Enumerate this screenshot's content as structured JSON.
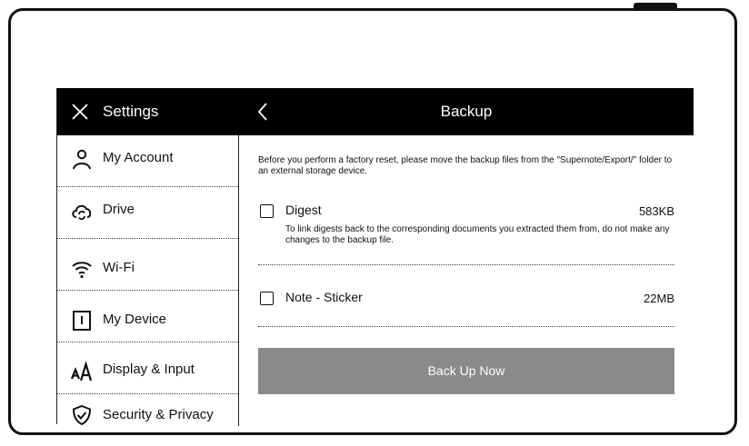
{
  "settings": {
    "title": "Settings",
    "close_icon": "close-icon"
  },
  "sidebar": {
    "items": [
      {
        "label": "My Account",
        "icon": "person-icon"
      },
      {
        "label": "Drive",
        "icon": "cloud-sync-icon"
      },
      {
        "label": "Wi-Fi",
        "icon": "wifi-icon"
      },
      {
        "label": "My Device",
        "icon": "tablet-icon"
      },
      {
        "label": "Display & Input",
        "icon": "font-size-icon"
      },
      {
        "label": "Security & Privacy",
        "icon": "shield-check-icon"
      }
    ]
  },
  "main": {
    "title": "Backup",
    "back_icon": "chevron-left-icon",
    "notice": "Before you perform a factory reset, please move the backup files from the \"Supernote/Export/\" folder to an external storage device.",
    "items": [
      {
        "name": "Digest",
        "size": "583KB",
        "checked": false,
        "description": "To link digests back to the corresponding documents you extracted them from, do not make any changes to the backup file."
      },
      {
        "name": "Note - Sticker",
        "size": "22MB",
        "checked": false,
        "description": ""
      }
    ],
    "backup_button": "Back Up Now"
  },
  "colors": {
    "titlebar": "#000000",
    "button_disabled": "#8a8a8a",
    "text": "#111111"
  }
}
